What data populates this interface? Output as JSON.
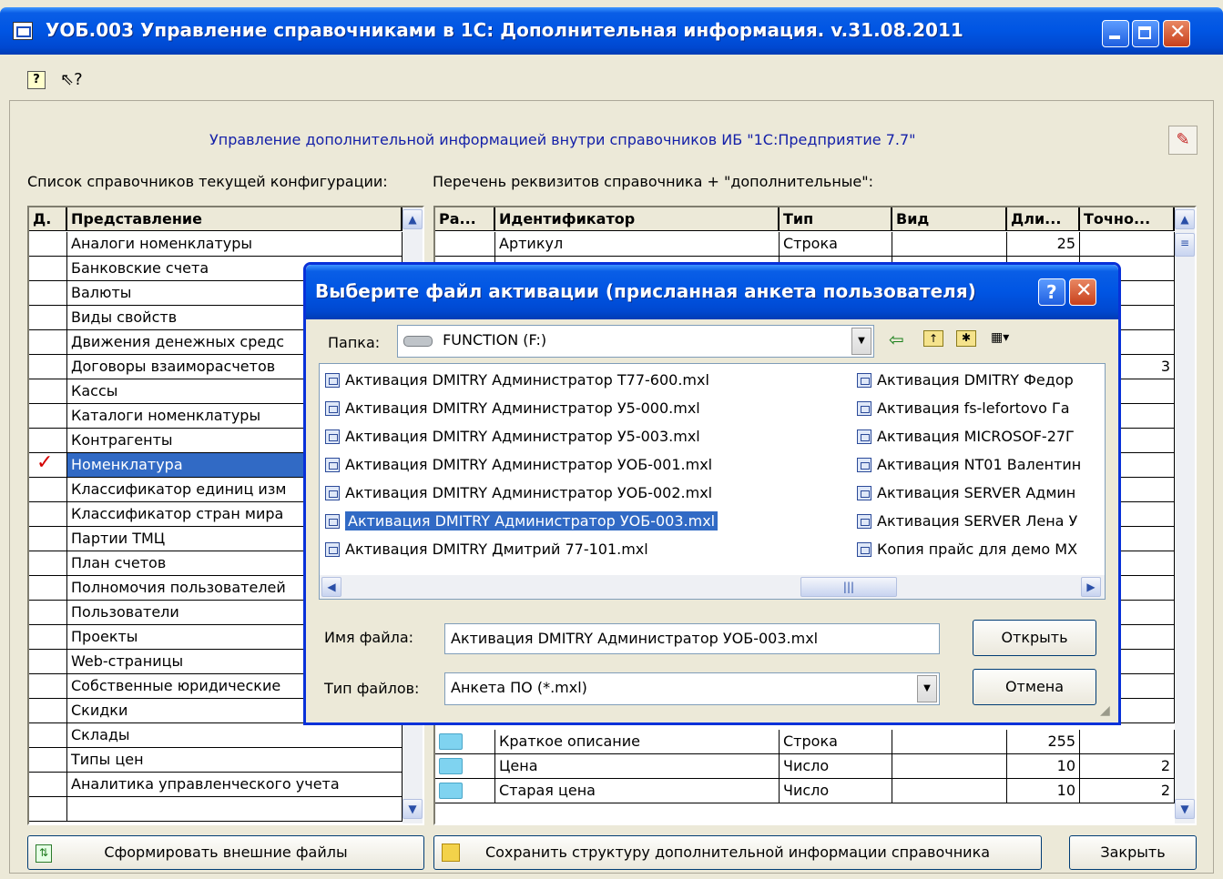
{
  "window": {
    "title": "УОБ.003 Управление справочниками в 1С: Дополнительная информация. v.31.08.2011",
    "header_info": "Управление дополнительной информацией внутри справочников ИБ \"1С:Предприятие 7.7\"",
    "left_label": "Список справочников текущей конфигурации:",
    "right_label": "Перечень реквизитов справочника + \"дополнительные\":"
  },
  "icons": {
    "toolbar_help": "help-icon",
    "toolbar_whatsthis": "whats-this-icon",
    "edit": "edit-icon",
    "check": "check-mark-icon"
  },
  "left_grid": {
    "headers": [
      "Д.",
      "Представление"
    ],
    "checkmark": "✓",
    "rows": [
      "Аналоги номенклатуры",
      "Банковские счета",
      "Валюты",
      "Виды свойств",
      "Движения денежных средс",
      "Договоры взаиморасчетов",
      "Кассы",
      "Каталоги номенклатуры",
      "Контрагенты",
      "Номенклатура",
      "Классификатор единиц изм",
      "Классификатор стран мира",
      "Партии ТМЦ",
      "План счетов",
      "Полномочия пользователей",
      "Пользователи",
      "Проекты",
      "Web-страницы",
      "Собственные юридические",
      "Скидки",
      "Склады",
      "Типы цен",
      "Аналитика управленческого учета"
    ]
  },
  "right_grid": {
    "headers": [
      "Ра...",
      "Идентификатор",
      "Тип",
      "Вид",
      "Дли...",
      "Точно..."
    ],
    "top_row": {
      "ident": "Артикул",
      "type": "Строка",
      "kind": "",
      "len": "25",
      "prec": ""
    },
    "partial_row_value": "3",
    "bottom_rows": [
      {
        "ident": "Краткое описание",
        "type": "Строка",
        "kind": "",
        "len": "255",
        "prec": ""
      },
      {
        "ident": "Цена",
        "type": "Число",
        "kind": "",
        "len": "10",
        "prec": "2"
      },
      {
        "ident": "Старая цена",
        "type": "Число",
        "kind": "",
        "len": "10",
        "prec": "2"
      }
    ]
  },
  "buttons": {
    "generate": "Сформировать внешние файлы",
    "save": "Сохранить структуру дополнительной информации справочника",
    "close": "Закрыть"
  },
  "dialog": {
    "title": "Выберите файл активации (присланная анкета пользователя)",
    "folder_label": "Папка:",
    "folder_value": "FUNCTION (F:)",
    "files_col1": [
      "Активация DMITRY Администратор Т77-600.mxl",
      "Активация DMITRY Администратор У5-000.mxl",
      "Активация DMITRY Администратор У5-003.mxl",
      "Активация DMITRY Администратор УОБ-001.mxl",
      "Активация DMITRY Администратор УОБ-002.mxl",
      "Активация DMITRY Администратор УОБ-003.mxl",
      "Активация DMITRY Дмитрий 77-101.mxl"
    ],
    "files_col2": [
      "Активация DMITRY Федор",
      "Активация fs-lefortovo Га",
      "Активация MICROSOF-27Г",
      "Активация NT01 Валентин",
      "Активация SERVER Админ",
      "Активация SERVER Лена У",
      "Копия прайс для демо МХ"
    ],
    "filename_label": "Имя файла:",
    "filename_value": "Активация DMITRY Администратор УОБ-003.mxl",
    "filetype_label": "Тип файлов:",
    "filetype_value": "Анкета ПО (*.mxl)",
    "open": "Открыть",
    "cancel": "Отмена",
    "help_glyph": "?",
    "close_glyph": "✕"
  }
}
